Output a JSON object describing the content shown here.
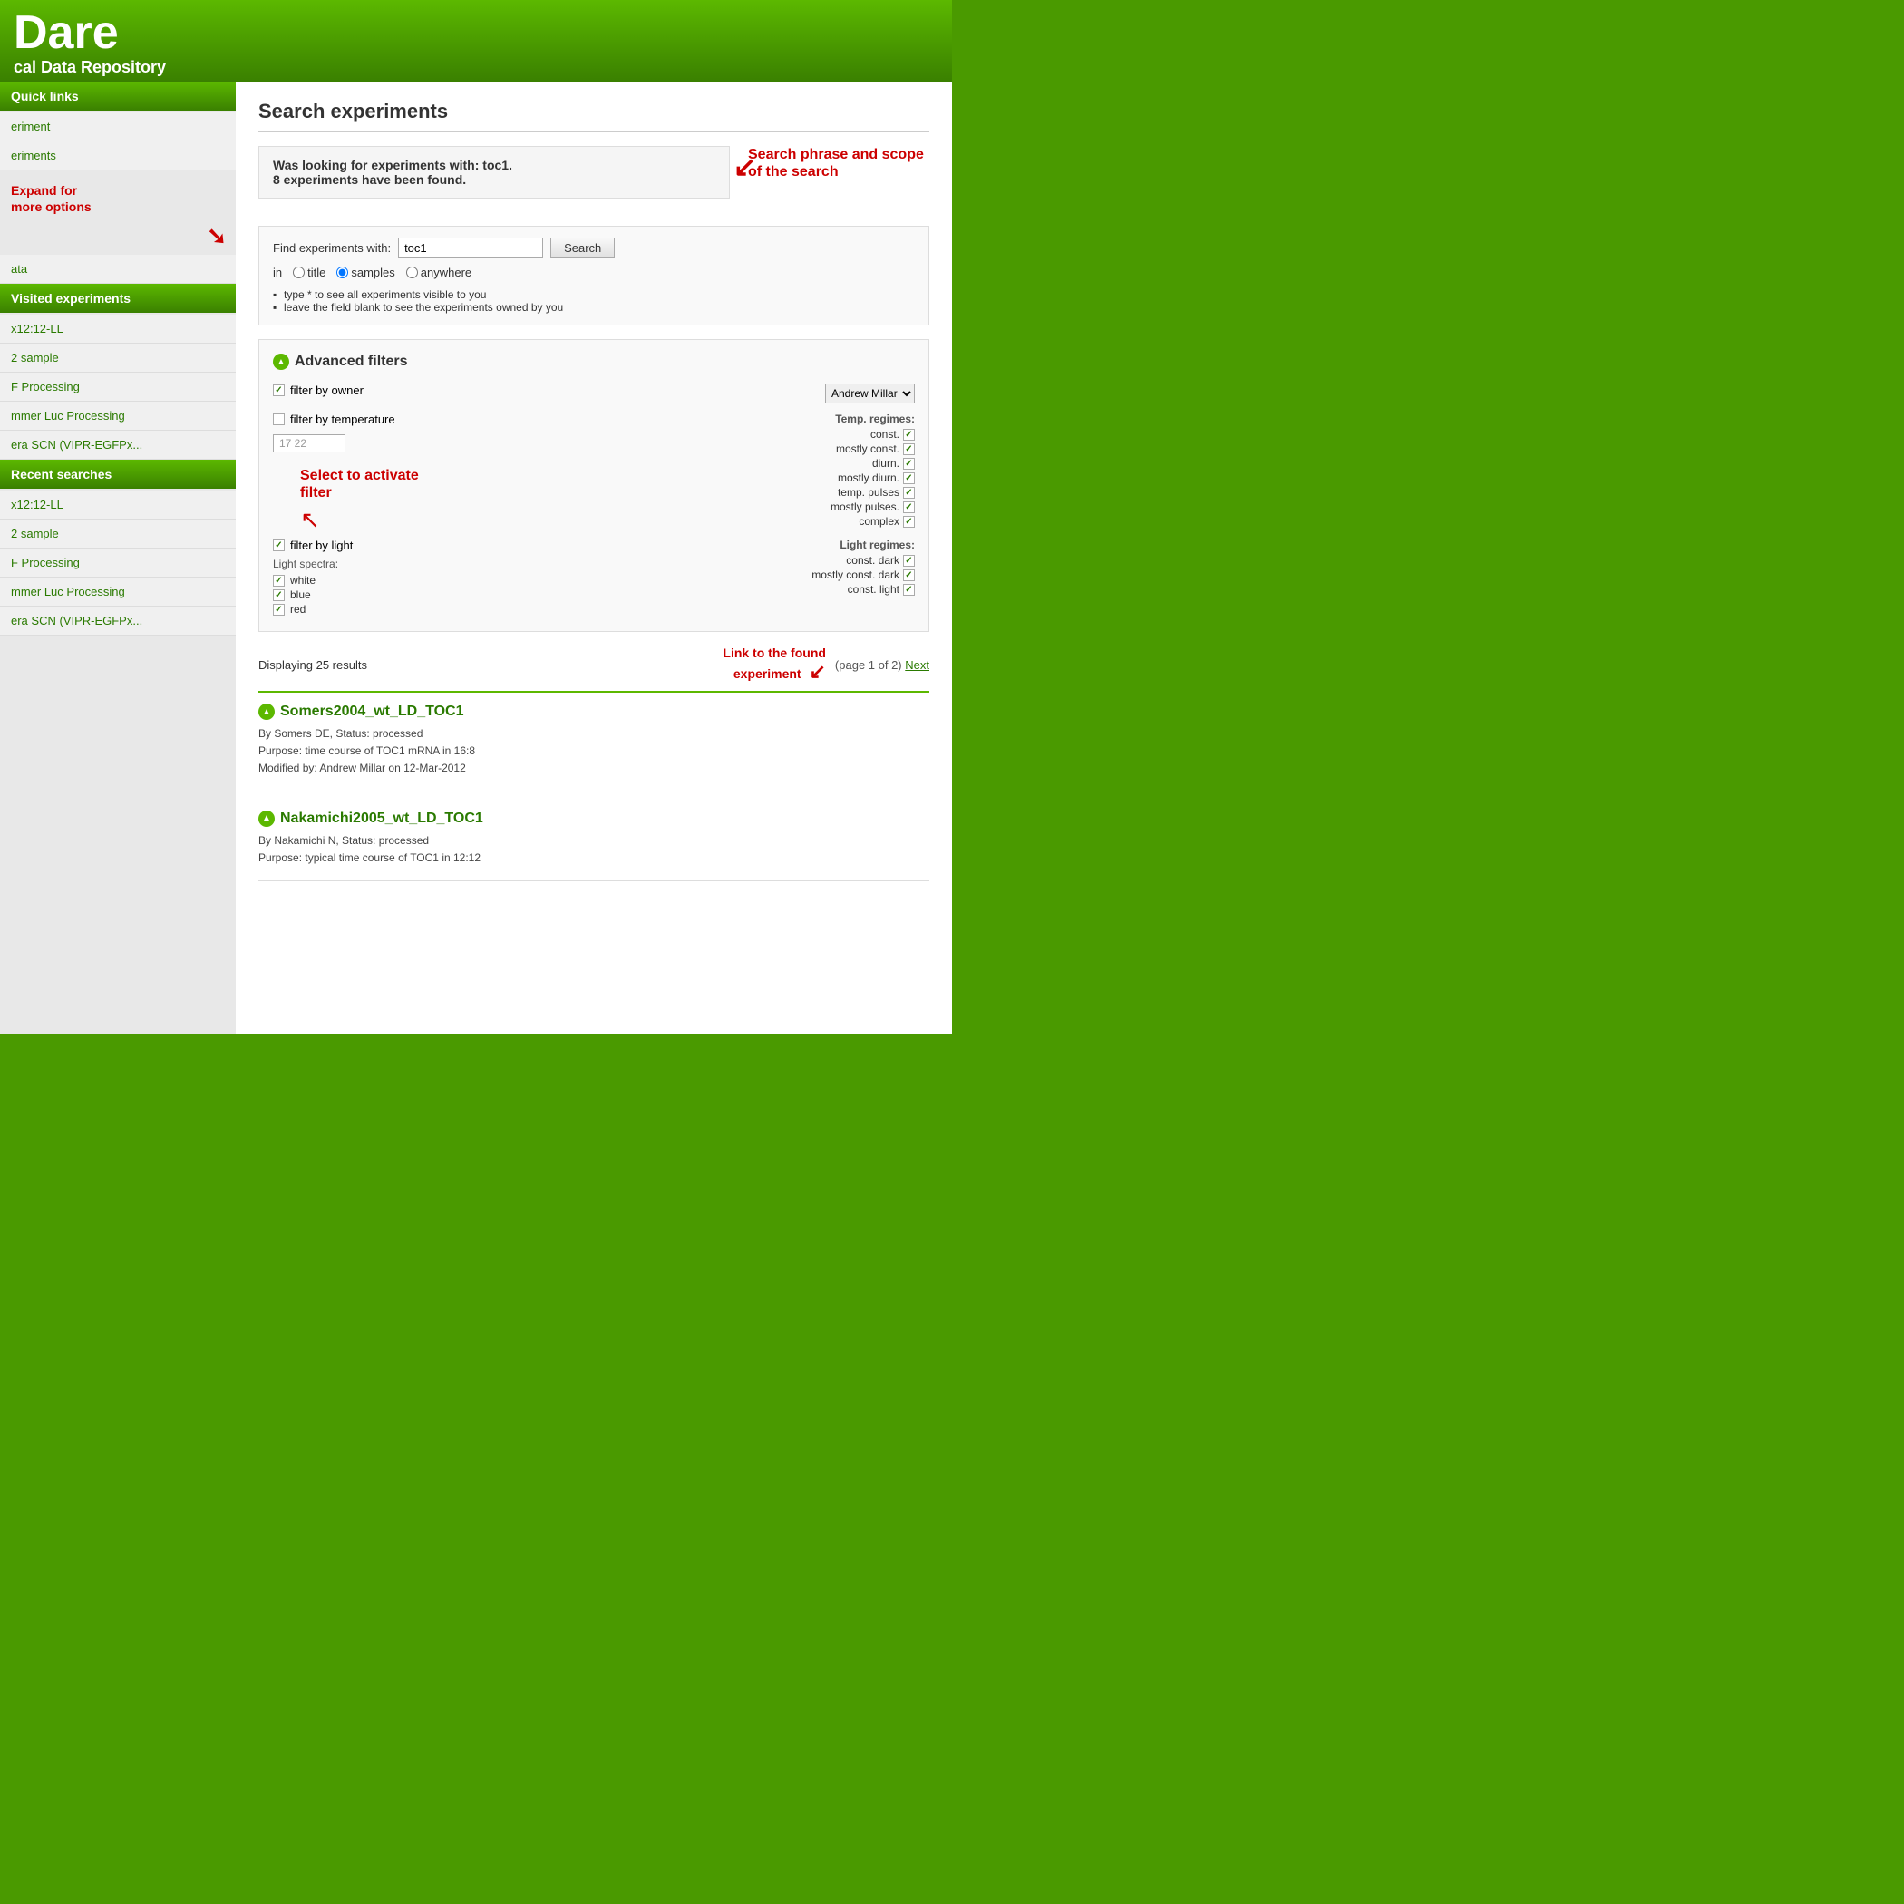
{
  "header": {
    "title": "Dare",
    "subtitle": "cal Data Repository"
  },
  "sidebar": {
    "quick_links_header": "Quick links",
    "quick_links_items": [
      {
        "label": "eriment"
      },
      {
        "label": "eriments"
      },
      {
        "label": "ata"
      }
    ],
    "expand_annotation": "Expand for\nmore options",
    "visited_header": "Visited experiments",
    "visited_items": [
      {
        "label": "x12:12-LL"
      },
      {
        "label": "2 sample"
      },
      {
        "label": "F Processing"
      },
      {
        "label": "mmer Luc Processing"
      },
      {
        "label": "era SCN (VIPR-EGFPx..."
      }
    ],
    "recent_header": "Recent searches",
    "recent_items": [
      {
        "label": "x12:12-LL"
      },
      {
        "label": "2 sample"
      },
      {
        "label": "F Processing"
      },
      {
        "label": "mmer Luc Processing"
      },
      {
        "label": "era SCN (VIPR-EGFPx..."
      }
    ]
  },
  "main": {
    "page_title": "Search experiments",
    "search_info": {
      "line1": "Was looking for experiments with: toc1.",
      "line2": "8 experiments have been found."
    },
    "search_phrase_annotation": "Search phrase and\nscope of the search",
    "search_form": {
      "label": "Find experiments with:",
      "input_value": "toc1",
      "search_button": "Search",
      "scope_label": "in",
      "scope_options": [
        "title",
        "samples",
        "anywhere"
      ],
      "scope_selected": "samples",
      "hint1": "type * to see all experiments visible to you",
      "hint2": "leave the field blank to see the experiments owned by you"
    },
    "advanced_filters": {
      "header": "Advanced filters",
      "filter_owner": {
        "label": "filter by owner",
        "checked": true,
        "owner_value": "Andrew Millar"
      },
      "filter_temperature": {
        "label": "filter by temperature",
        "checked": false,
        "temp_value": "17 22",
        "regimes_label": "Temp. regimes:",
        "regimes": [
          {
            "label": "const.",
            "checked": true
          },
          {
            "label": "mostly const.",
            "checked": true
          },
          {
            "label": "diurn.",
            "checked": true
          },
          {
            "label": "mostly diurn.",
            "checked": true
          },
          {
            "label": "temp. pulses",
            "checked": true
          },
          {
            "label": "mostly pulses.",
            "checked": true
          },
          {
            "label": "complex",
            "checked": true
          }
        ]
      },
      "select_annotation": "Select to activate\nfilter",
      "filter_light": {
        "label": "filter by light",
        "checked": true,
        "light_regimes_label": "Light regimes:",
        "light_regimes": [
          {
            "label": "const. dark",
            "checked": true
          },
          {
            "label": "mostly const. dark",
            "checked": true
          },
          {
            "label": "const. light",
            "checked": true
          }
        ],
        "spectra_label": "Light spectra:",
        "spectra": [
          {
            "label": "white",
            "checked": true
          },
          {
            "label": "blue",
            "checked": true
          },
          {
            "label": "red",
            "checked": true
          }
        ]
      }
    },
    "results": {
      "display_text": "Displaying 25 results",
      "pagination": "(page 1 of 2)",
      "next_label": "Next",
      "link_annotation": "Link to the found\nexperiment",
      "experiments": [
        {
          "title": "Somers2004_wt_LD_TOC1",
          "meta1": "By Somers DE, Status: processed",
          "meta2": "Purpose: time course of TOC1 mRNA in 16:8",
          "meta3": "Modified by: Andrew Millar on 12-Mar-2012"
        },
        {
          "title": "Nakamichi2005_wt_LD_TOC1",
          "meta1": "By Nakamichi N, Status: processed",
          "meta2": "Purpose: typical time course of TOC1 in 12:12"
        }
      ]
    }
  }
}
